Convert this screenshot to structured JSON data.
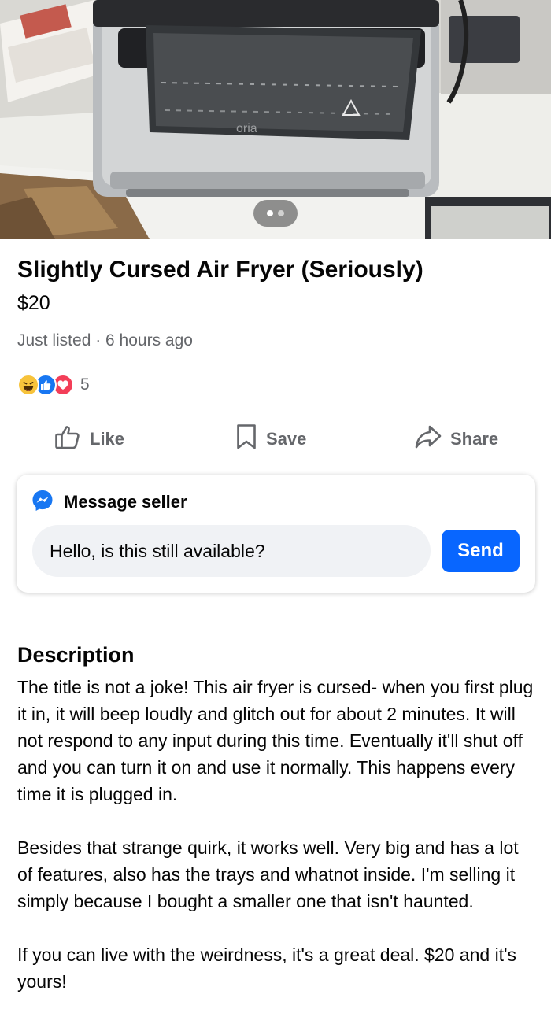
{
  "listing": {
    "title": "Slightly Cursed Air Fryer (Seriously)",
    "price": "$20",
    "meta": "Just listed · 6 hours ago",
    "reaction_count": "5",
    "photo_pages": 2,
    "photo_current": 1
  },
  "actions": {
    "like_label": "Like",
    "save_label": "Save",
    "share_label": "Share"
  },
  "message": {
    "header": "Message seller",
    "input_value": "Hello, is this still available?",
    "send_label": "Send"
  },
  "description": {
    "heading": "Description",
    "paragraphs": [
      "The title is not a joke! This air fryer is cursed- when you first plug it in, it will beep loudly and glitch out for about 2 minutes. It will not respond to any input during this time. Eventually it'll shut off and you can turn it on and use it normally. This happens every time it is plugged in.",
      "Besides that strange quirk, it works well. Very big and has a lot of features, also has the trays and whatnot inside. I'm selling it simply because I bought a smaller one that isn't haunted.",
      "If you can live with the weirdness, it's a great deal. $20 and it's yours!"
    ]
  },
  "photo": {
    "brand_mark": "oria"
  },
  "icons": {
    "like": "thumbs-up-icon",
    "save": "bookmark-icon",
    "share": "share-arrow-icon",
    "messenger": "messenger-icon",
    "reactions": [
      "haha-reaction-icon",
      "like-reaction-icon",
      "love-reaction-icon"
    ]
  },
  "colors": {
    "accent": "#0866ff",
    "messenger": "#1877f2",
    "secondary_text": "#65676b",
    "input_bg": "#f0f2f5",
    "love": "#f33e58",
    "haha": "#f7c33b"
  }
}
